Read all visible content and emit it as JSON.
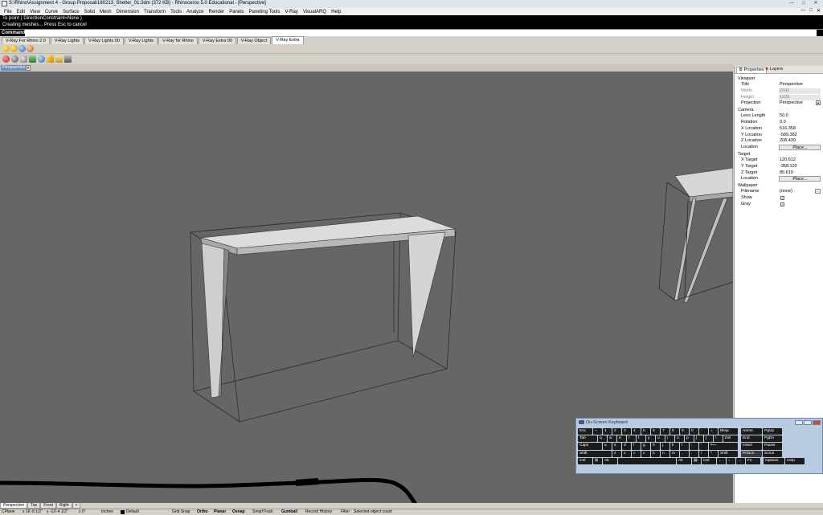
{
  "window": {
    "title": "S:\\Rhino\\Assignment 4 - Group Proposal\\180213_Shelter_01.3dm (372 KB) - Rhinoceros 5.0 Educational - [Perspective]",
    "controls": [
      "—",
      "□",
      "✕"
    ]
  },
  "menu": {
    "items": [
      "File",
      "Edit",
      "View",
      "Curve",
      "Surface",
      "Solid",
      "Mesh",
      "Dimension",
      "Transform",
      "Tools",
      "Analyze",
      "Render",
      "Panels",
      "Paneling Tools",
      "V-Ray",
      "VisualARQ",
      "Help"
    ],
    "right": [
      "—",
      "□",
      "✕"
    ]
  },
  "command": {
    "history": [
      "To point ( DirectionConstraint=None )",
      "Creating meshes... Press Esc to cancel"
    ],
    "label": "Command:",
    "value": ""
  },
  "toolbar_tabs": {
    "items": [
      "V-Ray For Rhino 2.0",
      "V-Ray Lights",
      "V-Ray Lights 00",
      "V-Ray Lights",
      "V-Ray for Rhino",
      "V-Ray Extra 00",
      "V-Ray Object",
      "V-Ray Extra"
    ],
    "active_index": 7
  },
  "viewport": {
    "name": "Perspective",
    "background": "#666666"
  },
  "properties_panel": {
    "tabs": [
      "Properties",
      "Layers"
    ],
    "sections": [
      {
        "name": "Viewport",
        "rows": [
          {
            "key": "Title",
            "value": "Perspective",
            "kind": "text"
          },
          {
            "key": "Width",
            "value": "2043",
            "kind": "disabled"
          },
          {
            "key": "Height",
            "value": "1028",
            "kind": "disabled"
          },
          {
            "key": "Projection",
            "value": "Perspective",
            "kind": "select"
          }
        ]
      },
      {
        "name": "Camera",
        "rows": [
          {
            "key": "Lens Length",
            "value": "50.0",
            "kind": "text"
          },
          {
            "key": "Rotation",
            "value": "0.0",
            "kind": "text"
          },
          {
            "key": "X Location",
            "value": "516.358",
            "kind": "text"
          },
          {
            "key": "Y Location",
            "value": "-589.382",
            "kind": "text"
          },
          {
            "key": "Z Location",
            "value": "208.439",
            "kind": "text"
          },
          {
            "key": "Location",
            "value": "Place...",
            "kind": "button"
          }
        ]
      },
      {
        "name": "Target",
        "rows": [
          {
            "key": "X Target",
            "value": "120.612",
            "kind": "text"
          },
          {
            "key": "Y Target",
            "value": "-358.120",
            "kind": "text"
          },
          {
            "key": "Z Target",
            "value": "85.619",
            "kind": "text"
          },
          {
            "key": "Location",
            "value": "Place...",
            "kind": "button"
          }
        ]
      },
      {
        "name": "Wallpaper",
        "rows": [
          {
            "key": "Filename",
            "value": "(none)",
            "kind": "browse"
          },
          {
            "key": "Show",
            "value": "✓",
            "kind": "check"
          },
          {
            "key": "Gray",
            "value": "✓",
            "kind": "check"
          }
        ]
      }
    ]
  },
  "osk": {
    "title": "On-Screen Keyboard",
    "rows": [
      [
        "Esc",
        "~",
        "1",
        "2",
        "3",
        "4",
        "5",
        "6",
        "7",
        "8",
        "9",
        "0",
        "-",
        "=",
        "Bksp",
        "Home",
        "PgUp"
      ],
      [
        "Tab",
        "q",
        "w",
        "e",
        "r",
        "t",
        "y",
        "u",
        "i",
        "o",
        "p",
        "[",
        "]",
        "\\",
        "Del",
        "End",
        "PgDn"
      ],
      [
        "Caps",
        "a",
        "s",
        "d",
        "f",
        "g",
        "h",
        "j",
        "k",
        "l",
        ";",
        "'",
        "⟵",
        "Insert",
        "Pause"
      ],
      [
        "Shift",
        "z",
        "x",
        "c",
        "v",
        "b",
        "n",
        "m",
        ",",
        ".",
        "/",
        "^",
        "Shift",
        "PrtScn",
        "ScrLk"
      ],
      [
        "Ctrl",
        "⊞",
        "Alt",
        "",
        "Alt",
        "▤",
        "Ctrl",
        "←",
        "↓",
        "→",
        "Fn",
        "Options",
        "Help"
      ]
    ]
  },
  "view_tabs": {
    "items": [
      "Perspective",
      "Top",
      "Front",
      "Right",
      "+"
    ],
    "active_index": 0
  },
  "status": {
    "cplane": "CPlane",
    "x": "x 16'-8 1/2\"",
    "y": "y -13'-4 1/2\"",
    "z": "z 0\"",
    "units": "Inches",
    "layer": "Default",
    "toggles": [
      "Grid Snap",
      "Ortho",
      "Planar",
      "Osnap",
      "SmartTrack",
      "Gumball",
      "Record History",
      "Filter"
    ],
    "bold_toggles": [
      "Ortho",
      "Planar",
      "Osnap",
      "Gumball"
    ],
    "message": "Selected object count"
  }
}
